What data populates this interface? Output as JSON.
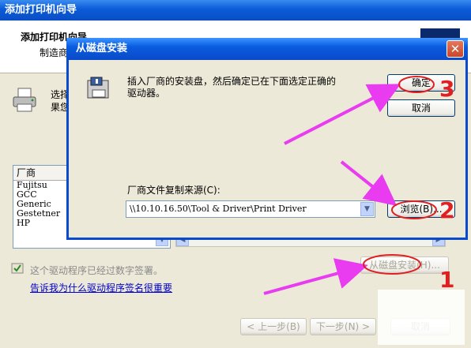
{
  "wizard": {
    "title": "添加打印机向导",
    "header_title": "添加打印机向导",
    "header_subtitle": "制造商",
    "desc_line1": "选择",
    "desc_line2": "果您",
    "manufacturer_header": "厂商",
    "manufacturers": [
      "Fujitsu",
      "GCC",
      "Generic",
      "Gestetner",
      "HP"
    ],
    "signed_text": "这个驱动程序已经过数字签署。",
    "signing_link": "告诉我为什么驱动程序签名很重要",
    "have_disk_button": "从磁盘安装(H)...",
    "back_button": "< 上一步(B)",
    "next_button": "下一步(N) >",
    "cancel_button": "取消"
  },
  "dialog": {
    "title": "从磁盘安装",
    "close_glyph": "✕",
    "message": "插入厂商的安装盘，然后确定已在下面选定正确的驱动器。",
    "ok_button": "确定",
    "cancel_button": "取消",
    "source_label": "厂商文件复制来源(C):",
    "source_value": "\\\\10.10.16.50\\Tool & Driver\\Print Driver",
    "browse_button": "浏览(B)..."
  },
  "annotations": {
    "step1": "1",
    "step2": "2",
    "step3": "3",
    "arrow_color": "#E93CF0",
    "number_color": "#E02020"
  },
  "icons": [
    "printer-icon",
    "floppy-disk-icon",
    "shield-icon",
    "chevron-down-icon",
    "scroll-left-icon",
    "scroll-right-icon",
    "close-icon"
  ]
}
